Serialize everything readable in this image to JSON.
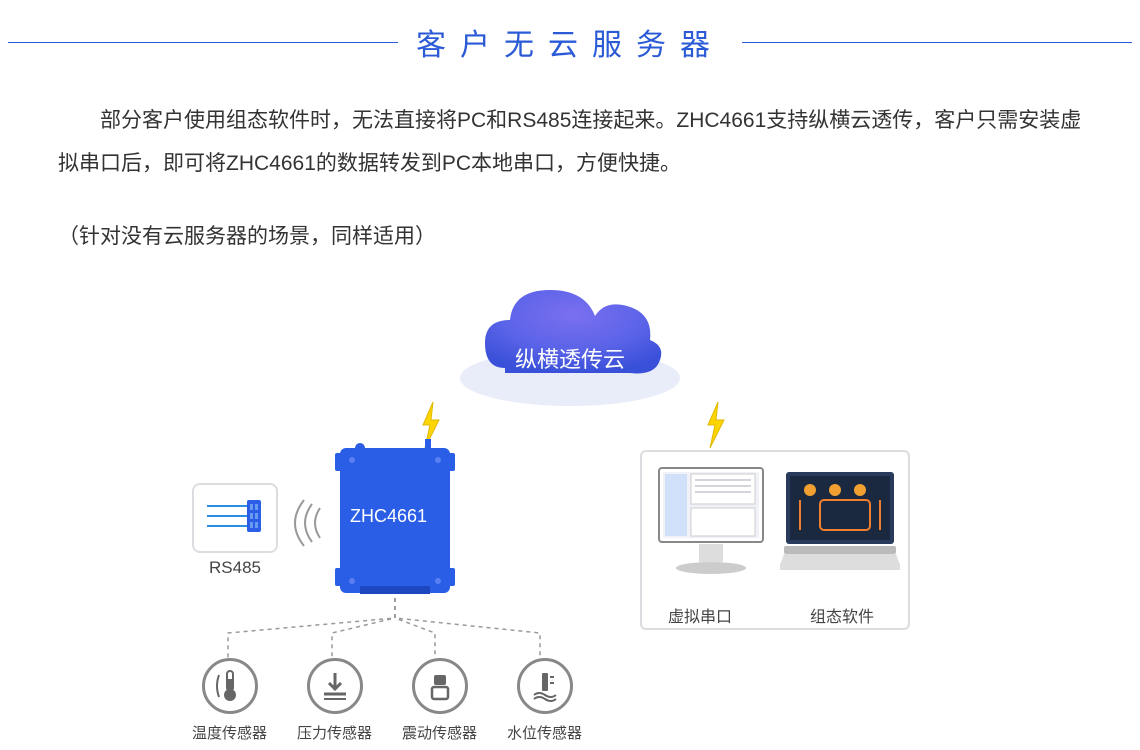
{
  "title": "客户无云服务器",
  "description": "部分客户使用组态软件时，无法直接将PC和RS485连接起来。ZHC4661支持纵横云透传，客户只需安装虚拟串口后，即可将ZHC4661的数据转发到PC本地串口，方便快捷。",
  "description_note": "（针对没有云服务器的场景，同样适用）",
  "cloud_label": "纵横透传云",
  "device_label": "ZHC4661",
  "rs485_label": "RS485",
  "monitor_labels": {
    "left": "虚拟串口",
    "right": "组态软件"
  },
  "sensors": [
    {
      "label": "温度传感器"
    },
    {
      "label": "压力传感器"
    },
    {
      "label": "震动传感器"
    },
    {
      "label": "水位传感器"
    }
  ]
}
